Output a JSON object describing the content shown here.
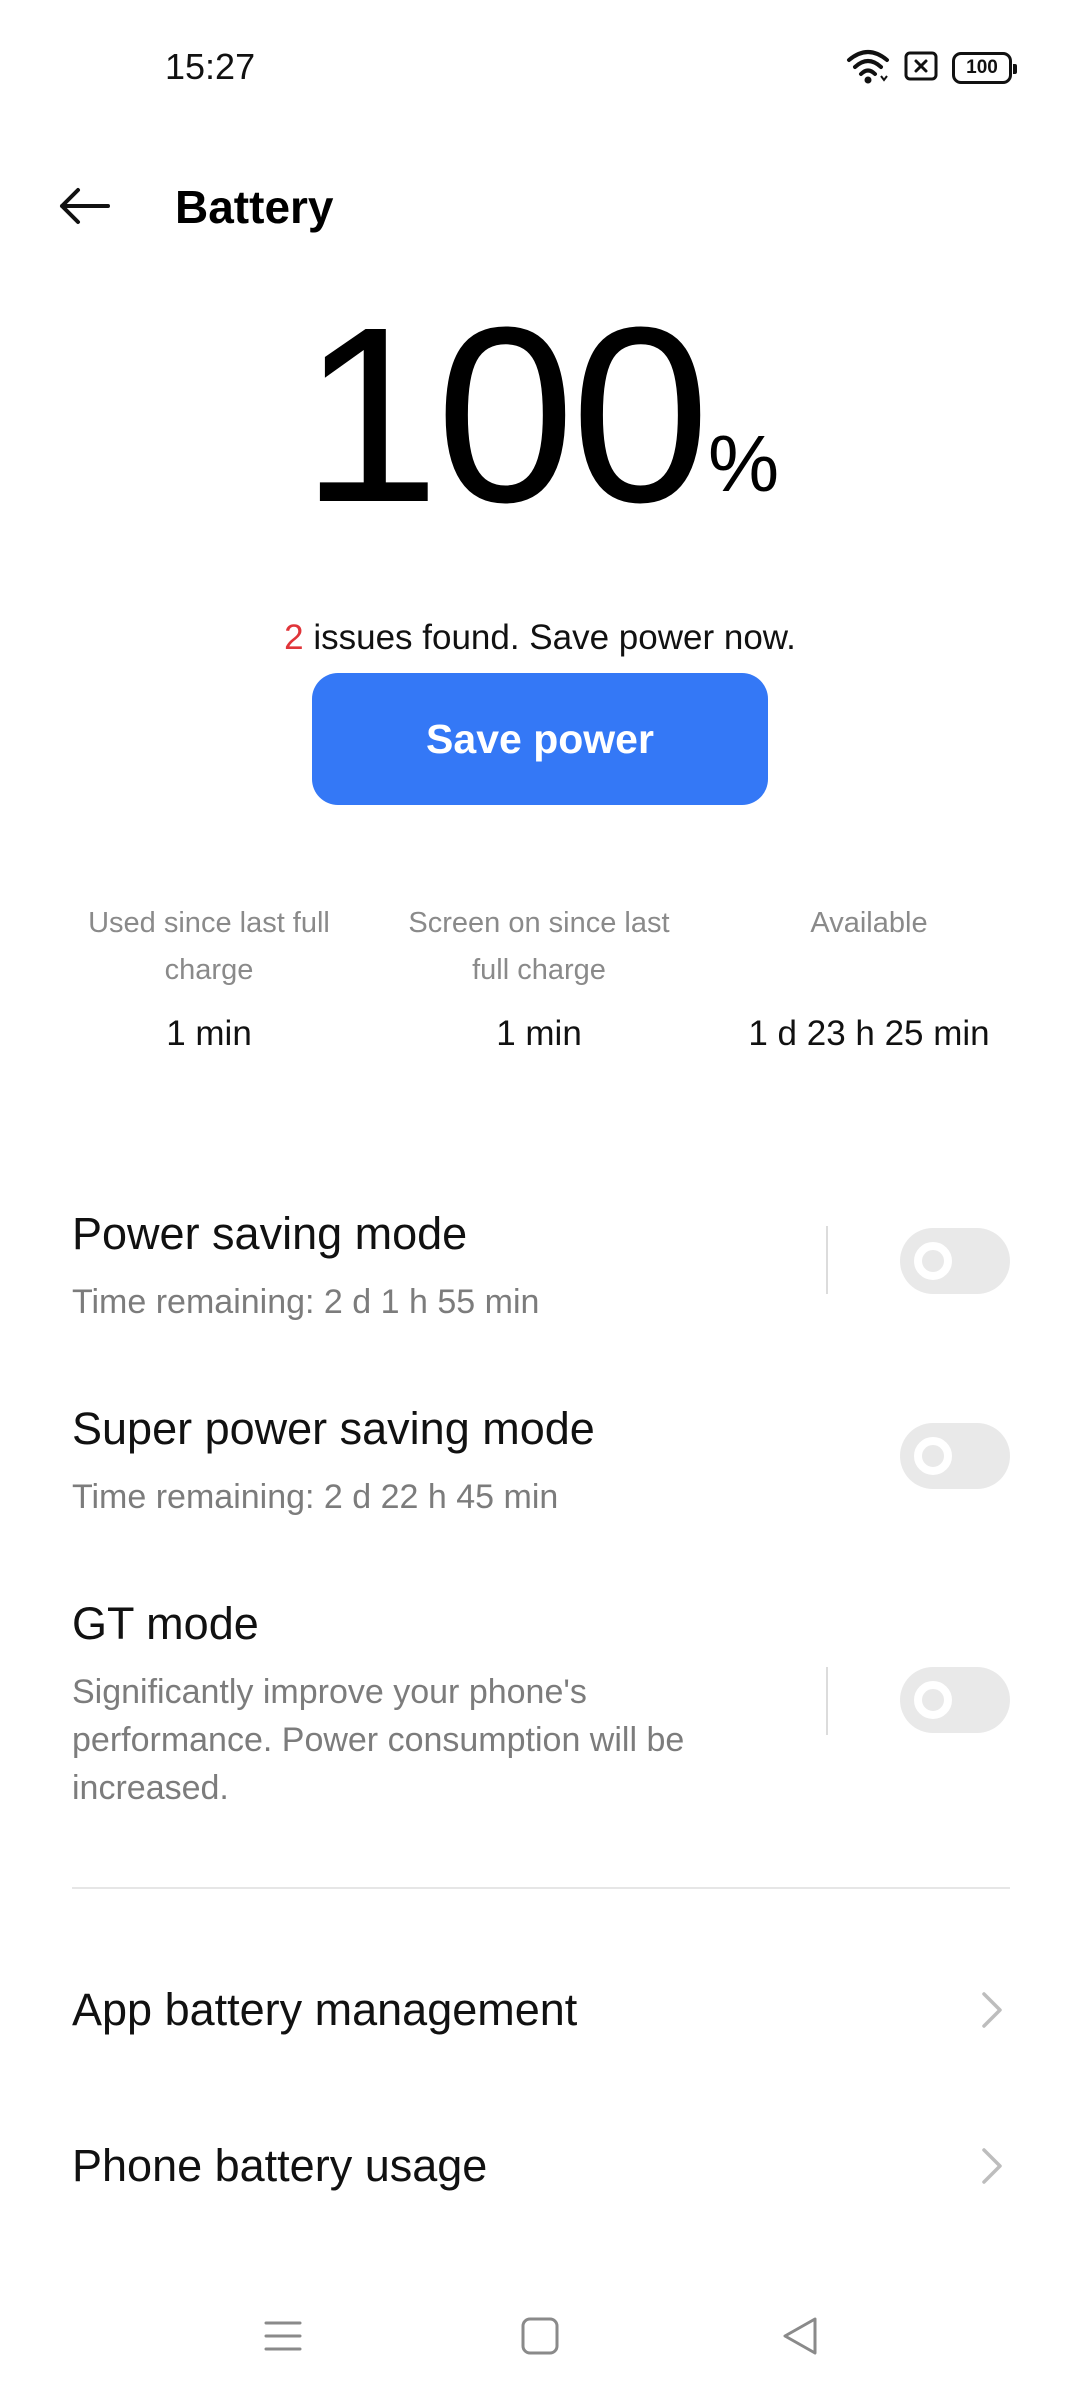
{
  "status_bar": {
    "time": "15:27",
    "battery_level": "100",
    "icons": [
      "wifi-icon",
      "sim-disabled-icon",
      "battery-icon"
    ]
  },
  "header": {
    "title": "Battery",
    "back_icon": "arrow-left-icon"
  },
  "battery": {
    "level": "100",
    "unit": "%"
  },
  "issues": {
    "count": "2",
    "text": " issues found. Save power now."
  },
  "save_button": {
    "label": "Save power",
    "color": "#3478f6"
  },
  "stats": [
    {
      "label": "Used since last full charge",
      "value": "1 min"
    },
    {
      "label": "Screen on since last full charge",
      "value": "1 min"
    },
    {
      "label": "Available",
      "value": "1 d 23 h 25 min"
    }
  ],
  "modes": [
    {
      "title": "Power saving mode",
      "subtitle": "Time remaining:  2 d 1 h 55 min",
      "enabled": false
    },
    {
      "title": "Super power saving mode",
      "subtitle": "Time remaining:  2 d 22 h 45 min",
      "enabled": false
    },
    {
      "title": "GT mode",
      "subtitle": "Significantly improve your phone's performance. Power consumption will be increased.",
      "enabled": false
    }
  ],
  "links": [
    {
      "label": "App battery management",
      "icon": "chevron-right-icon"
    },
    {
      "label": "Phone battery usage",
      "icon": "chevron-right-icon"
    }
  ],
  "system_nav": [
    "menu-icon",
    "home-icon",
    "back-icon"
  ],
  "colors": {
    "accent": "#3478f6",
    "issue_count": "#e0353a"
  }
}
